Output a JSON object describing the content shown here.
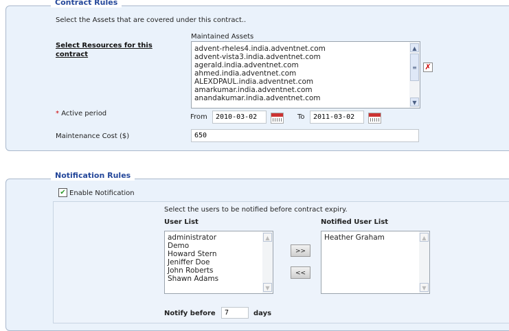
{
  "contract": {
    "legend": "Contract Rules",
    "intro": "Select the Assets that are covered under this contract..",
    "resources_link": "Select Resources for this contract",
    "assets_label": "Maintained Assets",
    "assets": [
      "advent-rheles4.india.adventnet.com",
      "advent-vista3.india.adventnet.com",
      "agerald.india.adventnet.com",
      "ahmed.india.adventnet.com",
      "ALEXDPAUL.india.adventnet.com",
      "amarkumar.india.adventnet.com",
      "anandakumar.india.adventnet.com"
    ],
    "required_mark": "*",
    "active_period_label": "Active period",
    "from_label": "From",
    "from_value": "2010-03-02",
    "to_label": "To",
    "to_value": "2011-03-02",
    "cost_label": "Maintenance Cost ($)",
    "cost_value": "650"
  },
  "notification": {
    "legend": "Notification Rules",
    "enable_label": "Enable Notification",
    "enabled": true,
    "intro": "Select the users to be notified before contract expiry.",
    "user_list_label": "User List",
    "users": [
      "administrator",
      "Demo",
      "Howard Stern",
      "Jeniffer Doe",
      "John Roberts",
      "Shawn Adams"
    ],
    "notified_label": "Notified User List",
    "notified_users": [
      "Heather Graham"
    ],
    "add_label": ">>",
    "remove_label": "<<",
    "notify_before_label": "Notify before",
    "notify_days": "7",
    "days_label": "days"
  }
}
